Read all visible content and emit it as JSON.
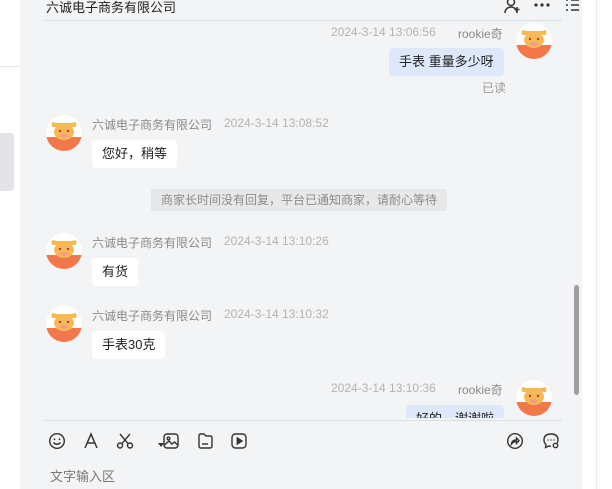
{
  "header": {
    "title": "六诚电子商务有限公司"
  },
  "messages": [
    {
      "direction": "out",
      "sender": "rookie奇",
      "time": "2024-3-14 13:06:56",
      "text": "手表 重量多少呀",
      "status": "已读"
    },
    {
      "direction": "in",
      "sender": "六诚电子商务有限公司",
      "time": "2024-3-14 13:08:52",
      "text": "您好，稍等"
    },
    {
      "direction": "in",
      "sender": "六诚电子商务有限公司",
      "time": "2024-3-14 13:10:26",
      "text": "有货"
    },
    {
      "direction": "in",
      "sender": "六诚电子商务有限公司",
      "time": "2024-3-14 13:10:32",
      "text": "手表30克"
    },
    {
      "direction": "out",
      "sender": "rookie奇",
      "time": "2024-3-14 13:10:36",
      "text": "好的，谢谢啦"
    }
  ],
  "system_notice": "商家长时间没有回复，平台已通知商家，请耐心等待",
  "composer": {
    "placeholder": "文字输入区"
  },
  "colors": {
    "panel_bg": "#f3f4f6",
    "outgoing_bubble": "#dde8fb",
    "incoming_bubble": "#ffffff",
    "avatar_orange": "#f2784b",
    "avatar_face": "#f7b955"
  },
  "icons": {
    "header": [
      "user-plus-icon",
      "more-icon",
      "list-icon"
    ],
    "toolbar": [
      "emoji-icon",
      "font-icon",
      "scissors-icon",
      "image-icon",
      "file-icon",
      "video-icon",
      "share-icon",
      "chat-settings-icon"
    ]
  }
}
